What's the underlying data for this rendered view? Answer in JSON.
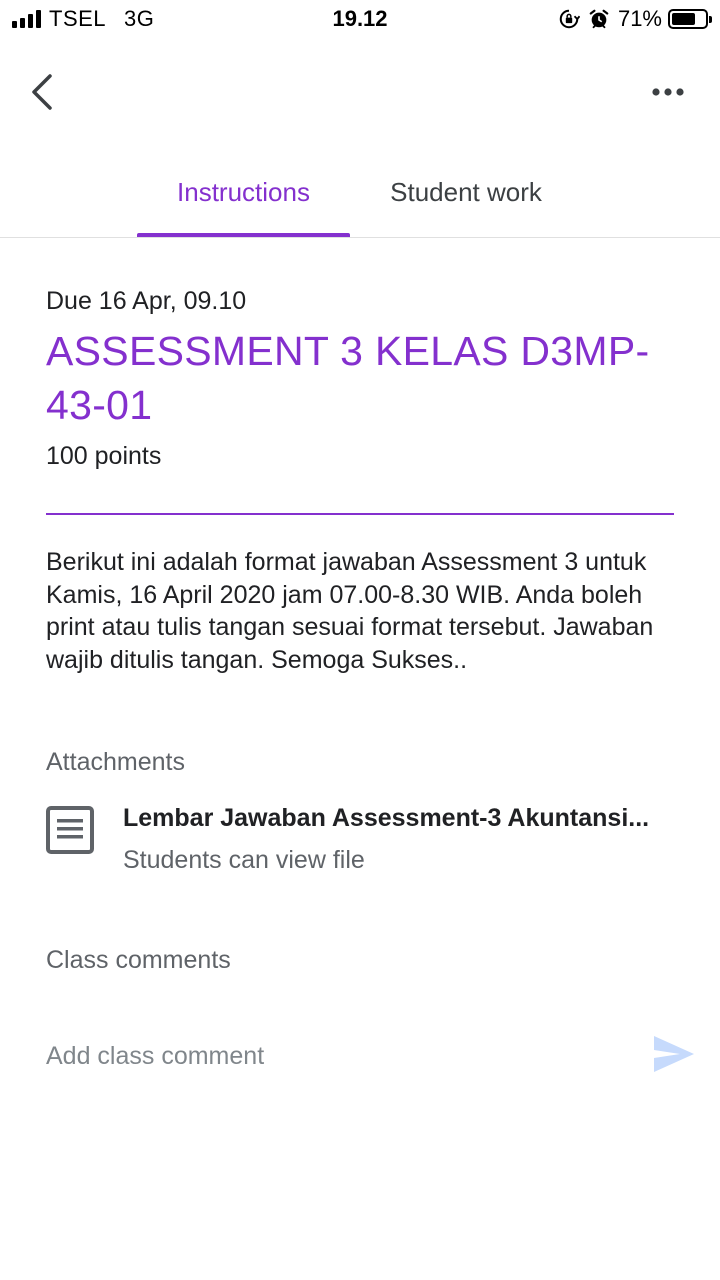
{
  "status_bar": {
    "carrier": "TSEL",
    "network": "3G",
    "time": "19.12",
    "battery_percent": "71%",
    "battery_level": 0.71
  },
  "top_bar": {
    "back_icon": "chevron-left-icon",
    "more_icon": "more-horizontal-icon"
  },
  "tabs": [
    {
      "label": "Instructions",
      "active": true
    },
    {
      "label": "Student work",
      "active": false
    }
  ],
  "assignment": {
    "due": "Due 16 Apr, 09.10",
    "title": "ASSESSMENT 3 KELAS D3MP-43-01",
    "points": "100 points",
    "description": "Berikut ini adalah format jawaban Assessment 3 untuk Kamis, 16 April 2020 jam 07.00-8.30 WIB. Anda boleh print atau tulis tangan sesuai format tersebut. Jawaban wajib ditulis tangan. Semoga Sukses.."
  },
  "attachments": {
    "label": "Attachments",
    "items": [
      {
        "icon": "document-icon",
        "title": "Lembar Jawaban Assessment-3 Akuntansi...",
        "subtitle": "Students can view file"
      }
    ]
  },
  "comments": {
    "label": "Class comments",
    "placeholder": "Add class comment",
    "send_icon": "send-icon"
  },
  "colors": {
    "accent": "#8430ce",
    "text_primary": "#202124",
    "text_secondary": "#5f6368",
    "send_disabled": "#c6dafc"
  }
}
